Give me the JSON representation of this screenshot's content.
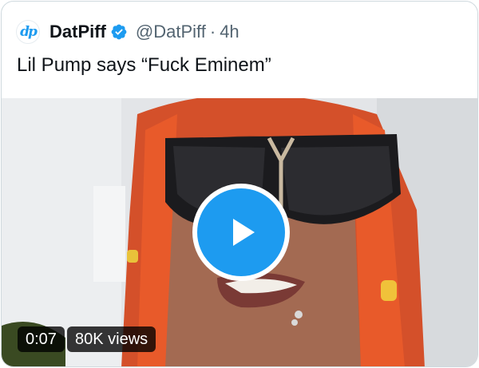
{
  "tweet": {
    "author_name": "DatPiff",
    "avatar_text": "dp",
    "handle": "@DatPiff",
    "separator": "·",
    "timestamp": "4h",
    "text": "Lil Pump says “Fuck Eminem”"
  },
  "video": {
    "duration": "0:07",
    "views": "80K views"
  },
  "icons": {
    "verified": "verified-badge-icon",
    "play": "play-icon"
  },
  "colors": {
    "accent": "#1d9bf0",
    "hair": "#e04a23",
    "text_secondary": "#536471"
  }
}
